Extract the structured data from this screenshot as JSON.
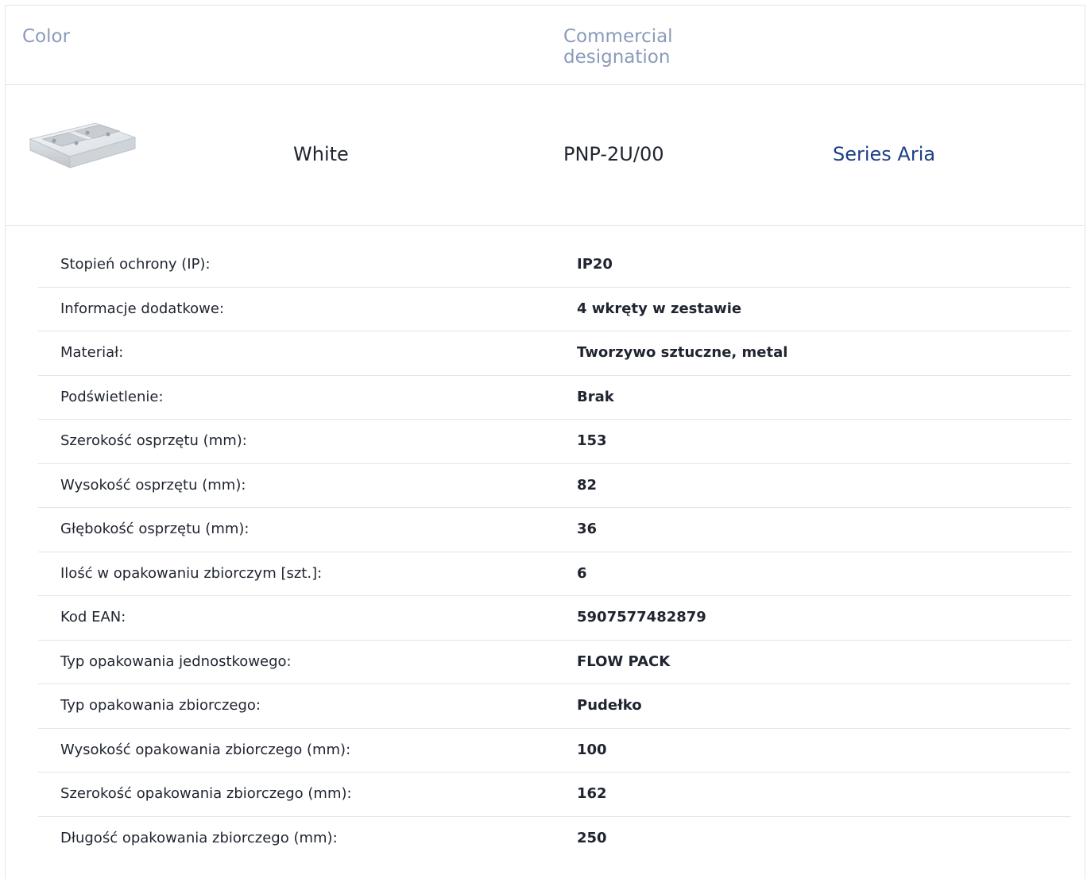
{
  "header": {
    "color_label": "Color",
    "designation_label": "Commercial designation"
  },
  "product": {
    "image_icon": "wall-box-double-icon",
    "color": "White",
    "code": "PNP-2U/00",
    "series_link": "Series Aria",
    "series_link_color": "#1e3f86"
  },
  "specs": [
    {
      "label": "Stopień ochrony (IP):",
      "value": "IP20"
    },
    {
      "label": "Informacje dodatkowe:",
      "value": "4 wkręty w zestawie"
    },
    {
      "label": "Materiał:",
      "value": "Tworzywo sztuczne, metal"
    },
    {
      "label": "Podświetlenie:",
      "value": "Brak"
    },
    {
      "label": "Szerokość osprzętu (mm):",
      "value": "153"
    },
    {
      "label": "Wysokość osprzętu (mm):",
      "value": "82"
    },
    {
      "label": "Głębokość osprzętu (mm):",
      "value": "36"
    },
    {
      "label": "Ilość w opakowaniu zbiorczym [szt.]:",
      "value": "6"
    },
    {
      "label": "Kod EAN:",
      "value": "5907577482879"
    },
    {
      "label": "Typ opakowania jednostkowego:",
      "value": "FLOW PACK"
    },
    {
      "label": "Typ opakowania zbiorczego:",
      "value": "Pudełko"
    },
    {
      "label": "Wysokość opakowania zbiorczego (mm):",
      "value": "100"
    },
    {
      "label": "Szerokość opakowania zbiorczego (mm):",
      "value": "162"
    },
    {
      "label": "Długość opakowania zbiorczego (mm):",
      "value": "250"
    }
  ]
}
